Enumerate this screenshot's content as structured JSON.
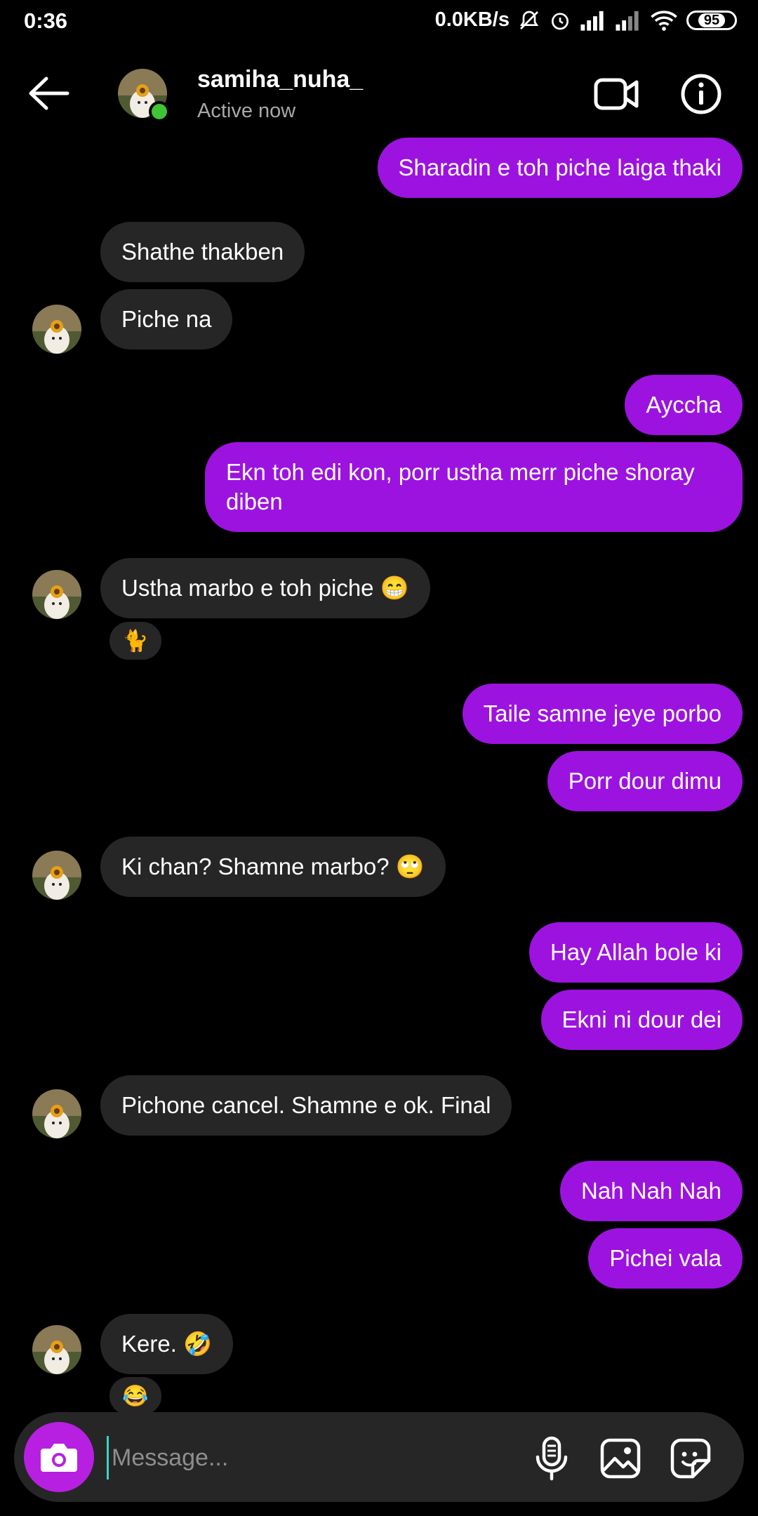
{
  "status_bar": {
    "time": "0:36",
    "net_speed": "0.0KB/s",
    "battery": "95",
    "icons": [
      "mute-icon",
      "alarm-icon",
      "signal-icon",
      "signal-icon",
      "wifi-icon",
      "battery-icon"
    ]
  },
  "header": {
    "username": "samiha_nuha_",
    "status": "Active now",
    "online_color": "#3ec434"
  },
  "colors": {
    "outgoing_bubble": "#9c13e0",
    "incoming_bubble": "#262626",
    "camera_button": "#b720e0"
  },
  "messages": [
    {
      "from": "me",
      "text": "Sharadin e toh piche laiga thaki"
    },
    {
      "from": "them",
      "text": "Shathe thakben"
    },
    {
      "from": "them",
      "text": "Piche na"
    },
    {
      "from": "me",
      "text": "Ayccha"
    },
    {
      "from": "me",
      "text": "Ekn toh edi kon, porr ustha merr piche shoray diben"
    },
    {
      "from": "them",
      "text": "Ustha marbo e toh piche 😁",
      "reaction": "🐈"
    },
    {
      "from": "me",
      "text": "Taile samne jeye porbo"
    },
    {
      "from": "me",
      "text": "Porr dour dimu"
    },
    {
      "from": "them",
      "text": "Ki chan? Shamne marbo? 🙄"
    },
    {
      "from": "me",
      "text": "Hay Allah bole ki"
    },
    {
      "from": "me",
      "text": "Ekni ni dour dei"
    },
    {
      "from": "them",
      "text": "Pichone cancel. Shamne e ok. Final"
    },
    {
      "from": "me",
      "text": "Nah Nah Nah"
    },
    {
      "from": "me",
      "text": "Pichei vala"
    },
    {
      "from": "them",
      "text": "Kere. 🤣",
      "reaction": "😂"
    }
  ],
  "composer": {
    "placeholder": "Message..."
  }
}
